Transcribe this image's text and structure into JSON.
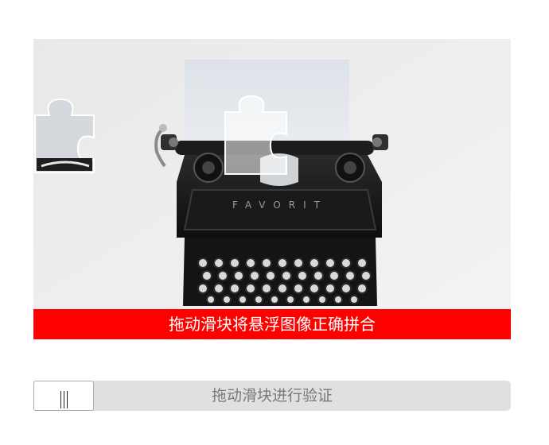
{
  "captcha": {
    "instruction_banner": "拖动滑块将悬浮图像正确拼合",
    "banner_color": "#ff0000",
    "image_subject": "typewriter-photo",
    "typewriter_brand": "FAVORIT",
    "puzzle_piece_icon": "jigsaw-piece-icon",
    "puzzle_slot_icon": "jigsaw-slot-icon"
  },
  "slider": {
    "hint": "拖动滑块进行验证",
    "handle_icon": "grip-lines-icon",
    "position": 0
  }
}
